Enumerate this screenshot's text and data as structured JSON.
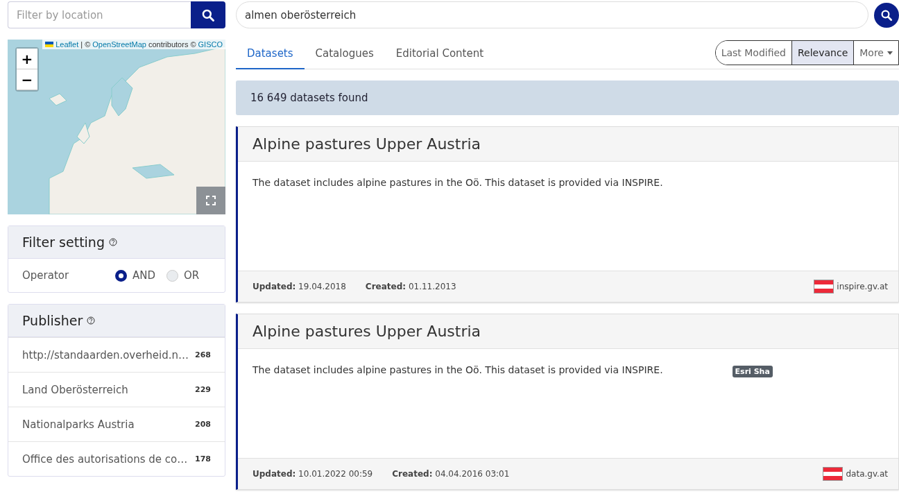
{
  "location_search": {
    "placeholder": "Filter by location"
  },
  "map": {
    "attribution": [
      {
        "text": "Leaflet",
        "link": true
      },
      {
        "text": "| ©",
        "link": false
      },
      {
        "text": "OpenStreetMap",
        "link": true
      },
      {
        "text": "contributors ©",
        "link": false
      },
      {
        "text": "GISCO",
        "link": true
      }
    ],
    "zoom_in": "+",
    "zoom_out": "−"
  },
  "filter_setting": {
    "title": "Filter setting",
    "operator_label": "Operator",
    "options": [
      {
        "label": "AND",
        "selected": true
      },
      {
        "label": "OR",
        "selected": false
      }
    ]
  },
  "publisher": {
    "title": "Publisher",
    "items": [
      {
        "name": "http://standaarden.overheid.n…",
        "count": "268"
      },
      {
        "name": "Land Oberösterreich",
        "count": "229"
      },
      {
        "name": "Nationalparks Austria",
        "count": "208"
      },
      {
        "name": "Office des autorisations de co…",
        "count": "178"
      }
    ]
  },
  "search": {
    "value": "almen oberösterreich"
  },
  "tabs": [
    {
      "label": "Datasets",
      "selected": true
    },
    {
      "label": "Catalogues",
      "selected": false
    },
    {
      "label": "Editorial Content",
      "selected": false
    }
  ],
  "sort": [
    {
      "label": "Last Modified",
      "selected": false,
      "kind": "option"
    },
    {
      "label": "Relevance",
      "selected": true,
      "kind": "option"
    },
    {
      "label": "More",
      "selected": false,
      "kind": "dropdown"
    }
  ],
  "result_count": "16 649 datasets found",
  "results": [
    {
      "title": "Alpine pastures Upper Austria",
      "description": "The dataset includes alpine pastures in the Oö. This dataset is provided via INSPIRE.",
      "updated": "**Updated:** 19.04.2018",
      "created": "**Created:** 01.11.2013",
      "source": "inspire.gv.at"
    },
    {
      "title": "Alpine pastures Upper Austria",
      "description": "The dataset includes alpine pastures in the Oö. This dataset is provided via INSPIRE.",
      "badge": "Esri Sha",
      "updated": "**Updated:** 10.01.2022 00:59",
      "created": "**Created:** 04.04.2016 03:01",
      "source": "data.gv.at"
    }
  ]
}
